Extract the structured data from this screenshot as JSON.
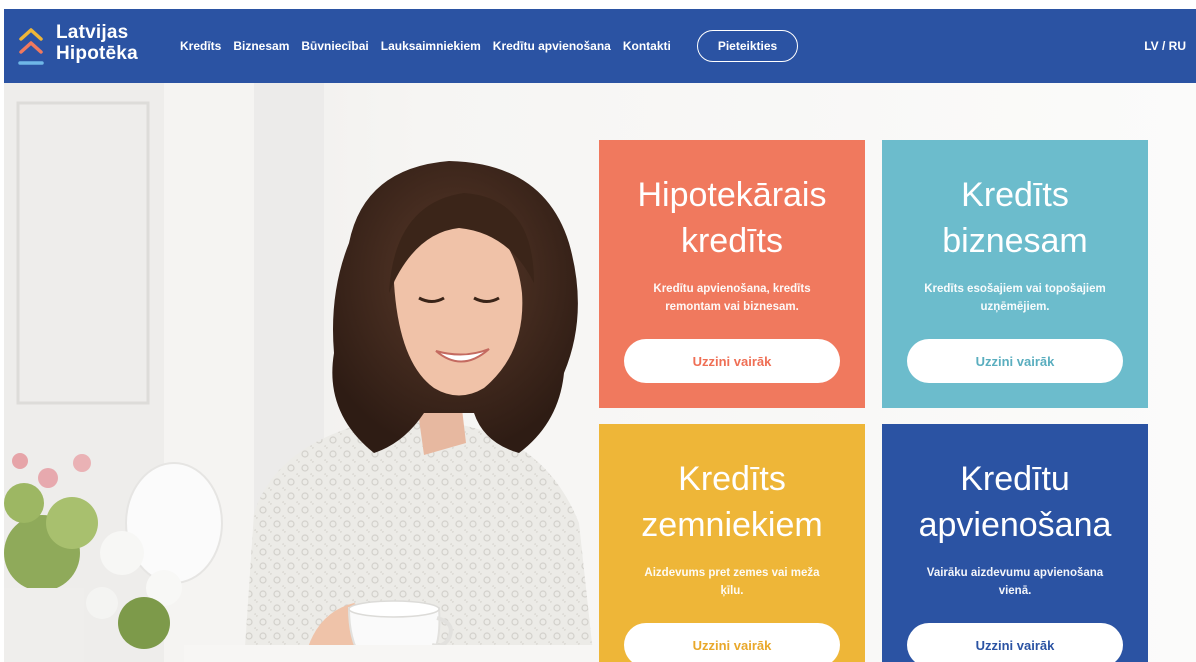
{
  "brand": {
    "line1": "Latvijas",
    "line2": "Hipotēka",
    "colors": {
      "blue": "#2b53a3",
      "orange": "#f0795e",
      "teal": "#6cbccc",
      "yellow": "#eeb638",
      "accent_light_blue": "#6fb7e8"
    }
  },
  "nav": {
    "items": [
      "Kredīts",
      "Biznesam",
      "Būvniecībai",
      "Lauksaimniekiem",
      "Kredītu apvienošana",
      "Kontakti"
    ],
    "apply_label": "Pieteikties",
    "lang_label": "LV / RU"
  },
  "cards": [
    {
      "title_line1": "Hipotekārais",
      "title_line2": "kredīts",
      "desc": "Kredītu apvienošana, kredīts remontam vai biznesam.",
      "button": "Uzzini vairāk"
    },
    {
      "title_line1": "Kredīts",
      "title_line2": "biznesam",
      "desc": "Kredīts esošajiem vai topošajiem uzņēmējiem.",
      "button": "Uzzini vairāk"
    },
    {
      "title_line1": "Kredīts",
      "title_line2": "zemniekiem",
      "desc": "Aizdevums pret zemes vai meža ķīlu.",
      "button": "Uzzini vairāk"
    },
    {
      "title_line1": "Kredītu",
      "title_line2": "apvienošana",
      "desc": "Vairāku aizdevumu apvienošana vienā.",
      "button": "Uzzini vairāk"
    }
  ]
}
